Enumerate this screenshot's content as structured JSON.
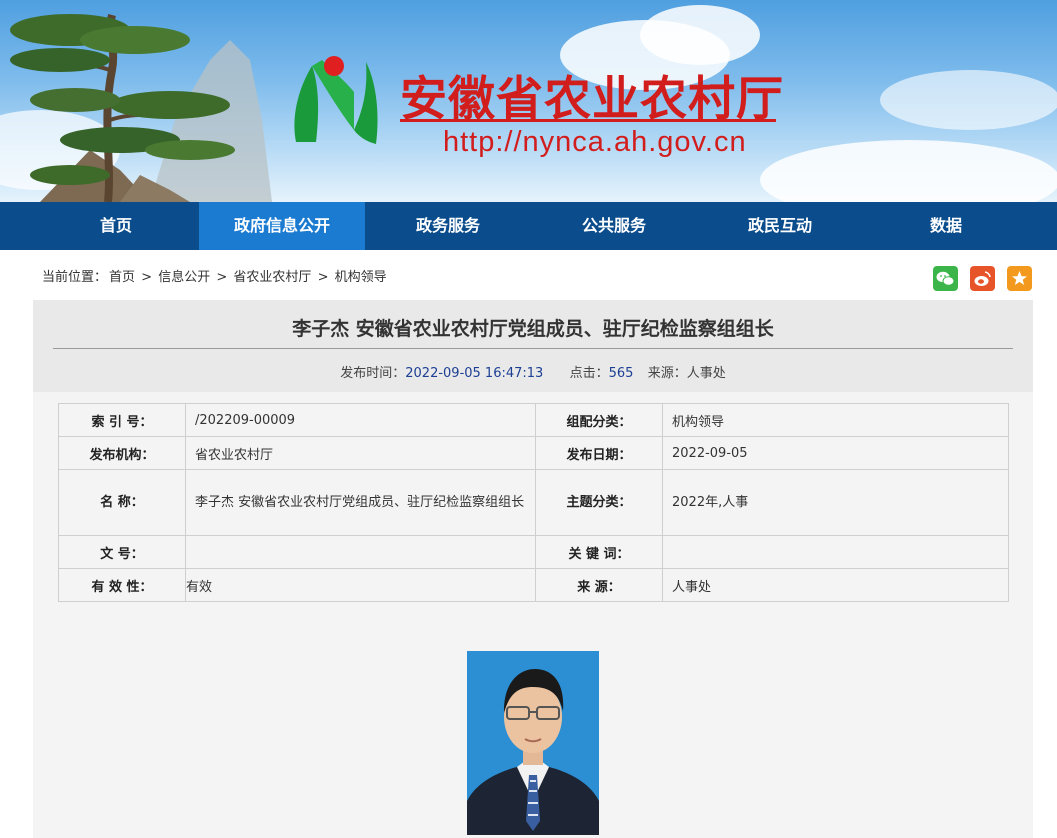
{
  "header": {
    "site_title": "安徽省农业农村厅",
    "site_url": "http://nynca.ah.gov.cn"
  },
  "nav": {
    "items": [
      {
        "label": "首页",
        "active": false
      },
      {
        "label": "政府信息公开",
        "active": true
      },
      {
        "label": "政务服务",
        "active": false
      },
      {
        "label": "公共服务",
        "active": false
      },
      {
        "label": "政民互动",
        "active": false
      },
      {
        "label": "数据",
        "active": false
      }
    ]
  },
  "breadcrumb": {
    "prefix": "当前位置：",
    "items": [
      "首页",
      "信息公开",
      "省农业农村厅",
      "机构领导"
    ],
    "separator": ">"
  },
  "share": {
    "wechat": {
      "icon": "wechat-icon",
      "color": "#3bb54a"
    },
    "weibo": {
      "icon": "weibo-icon",
      "color": "#e8542a"
    },
    "favorite": {
      "icon": "star-icon",
      "color": "#f39a1e"
    }
  },
  "article": {
    "title": "李子杰  安徽省农业农村厅党组成员、驻厅纪检监察组组长",
    "publish_time_label": "发布时间：",
    "publish_time": "2022-09-05 16:47:13",
    "clicks_label": "点击：",
    "clicks": "565",
    "source_label": "来源：",
    "source": "人事处"
  },
  "info_table": {
    "index_no_label": "索  引  号：",
    "index_no": "/202209-00009",
    "category_label": "组配分类：",
    "category": "机构领导",
    "issuer_label": "发布机构：",
    "issuer": "省农业农村厅",
    "date_label": "发布日期：",
    "date": "2022-09-05",
    "name_label": "名      称：",
    "name": "李子杰  安徽省农业农村厅党组成员、驻厅纪检监察组组长",
    "topic_label": "主题分类：",
    "topic": "2022年,人事",
    "doc_no_label": "文      号：",
    "doc_no": "",
    "keywords_label": "关  键  词：",
    "keywords": "",
    "validity_label": "有 效 性：",
    "validity": "有效",
    "source_label": "来      源：",
    "source": "人事处"
  },
  "colors": {
    "nav_bg": "#0b4d8c",
    "nav_active": "#1a7bd1",
    "title_red": "#d21d1d",
    "meta_blue": "#1c3f94"
  }
}
